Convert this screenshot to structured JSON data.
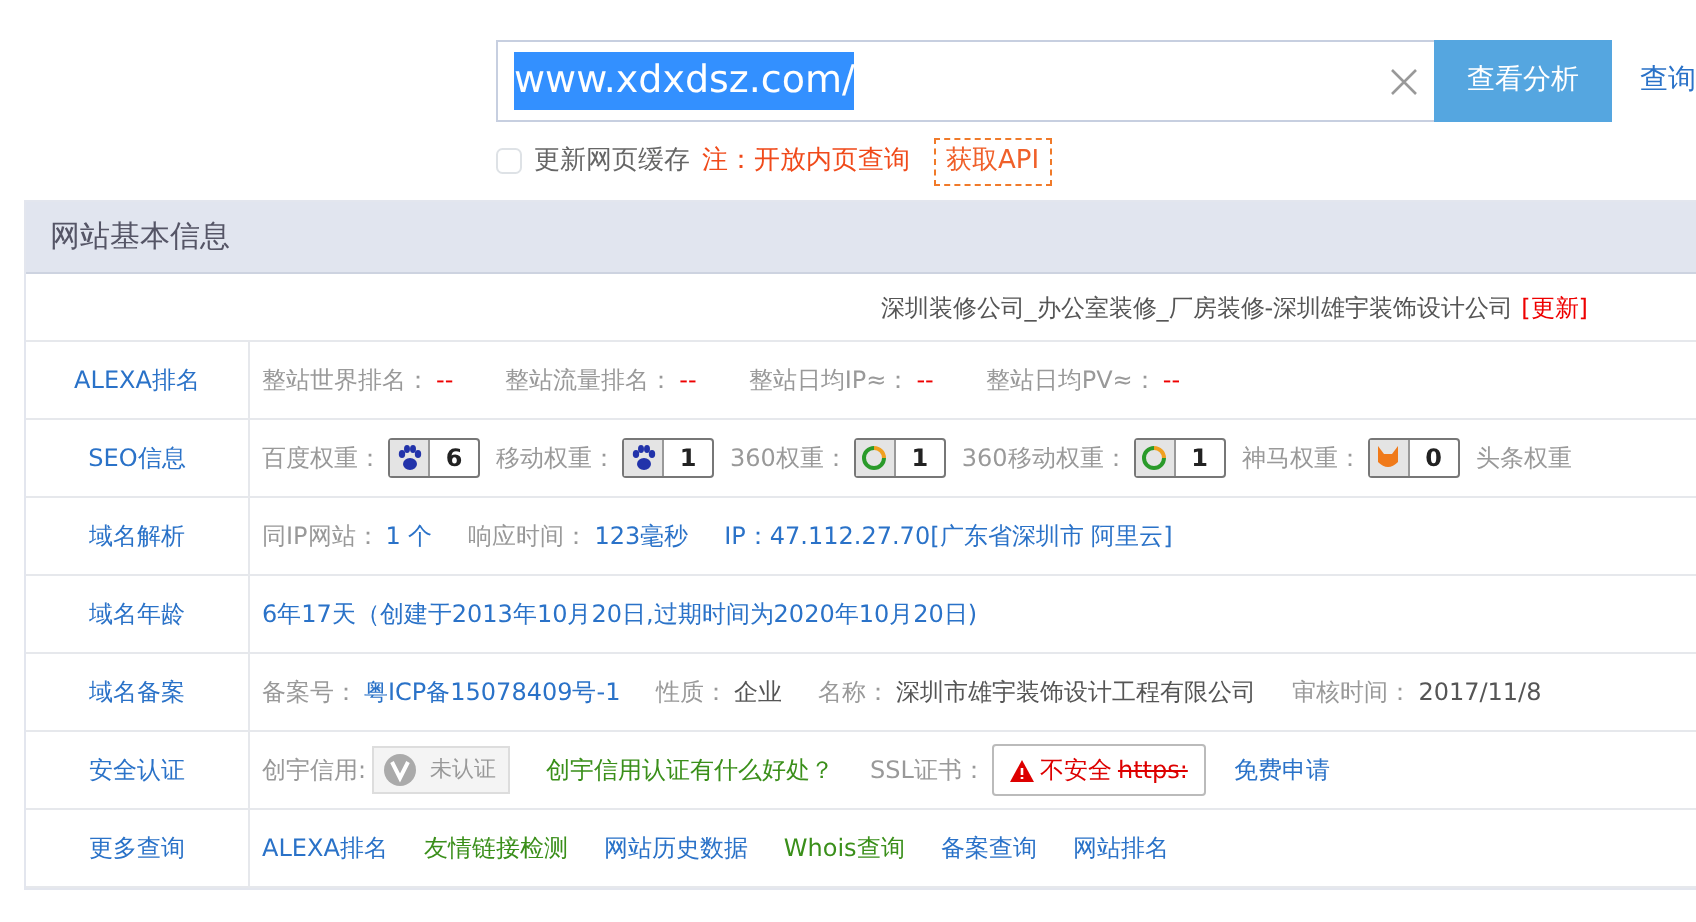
{
  "search": {
    "value": "www.xdxdsz.com/",
    "button": "查看分析",
    "side_link": "查询"
  },
  "options": {
    "checkbox_label": "更新网页缓存",
    "checked": false,
    "note": "注：开放内页查询",
    "api": "获取API"
  },
  "section": {
    "title": "网站基本信息",
    "site_title": "深圳装修公司_办公室装修_厂房装修-深圳雄宇装饰设计公司",
    "refresh": "[更新]"
  },
  "rows": [
    {
      "label": "ALEXA排名",
      "items": [
        {
          "kind": "label",
          "text": "整站世界排名："
        },
        {
          "kind": "dash",
          "text": "--"
        },
        {
          "kind": "label",
          "text": "整站流量排名："
        },
        {
          "kind": "dash",
          "text": "--"
        },
        {
          "kind": "label",
          "text": "整站日均IP≈："
        },
        {
          "kind": "dash",
          "text": "--"
        },
        {
          "kind": "label",
          "text": "整站日均PV≈："
        },
        {
          "kind": "dash",
          "text": "--"
        }
      ]
    },
    {
      "label": "SEO信息",
      "items": [
        {
          "kind": "label",
          "text": "百度权重："
        },
        {
          "kind": "paw-badge",
          "text": "6"
        },
        {
          "kind": "label",
          "text": "移动权重："
        },
        {
          "kind": "paw-badge",
          "text": "1"
        },
        {
          "kind": "label",
          "text": "360权重："
        },
        {
          "kind": "ring-badge",
          "text": "1"
        },
        {
          "kind": "label",
          "text": "360移动权重："
        },
        {
          "kind": "ring-badge",
          "text": "1"
        },
        {
          "kind": "label",
          "text": "神马权重："
        },
        {
          "kind": "fox-badge",
          "text": "0"
        },
        {
          "kind": "label",
          "text": "头条权重"
        }
      ]
    },
    {
      "label": "域名解析",
      "items": [
        {
          "kind": "label",
          "text": "同IP网站："
        },
        {
          "kind": "link",
          "text": "1 个"
        },
        {
          "kind": "label",
          "text": "响应时间："
        },
        {
          "kind": "value",
          "text": "123毫秒"
        },
        {
          "kind": "link",
          "text": "IP：47.112.27.70[广东省深圳市 阿里云]"
        }
      ]
    },
    {
      "label": "域名年龄",
      "items": [
        {
          "kind": "value",
          "text": "6年17天（创建于2013年10月20日,过期时间为2020年10月20日)"
        }
      ]
    },
    {
      "label": "域名备案",
      "items": [
        {
          "kind": "label",
          "text": "备案号："
        },
        {
          "kind": "link",
          "text": "粤ICP备15078409号-1"
        },
        {
          "kind": "label",
          "text": "性质："
        },
        {
          "kind": "text",
          "text": "企业"
        },
        {
          "kind": "label",
          "text": "名称："
        },
        {
          "kind": "text",
          "text": "深圳市雄宇装饰设计工程有限公司"
        },
        {
          "kind": "label",
          "text": "审核时间："
        },
        {
          "kind": "text",
          "text": "2017/11/8"
        }
      ]
    },
    {
      "label": "安全认证",
      "items": [
        {
          "kind": "label",
          "text": "创宇信用:"
        },
        {
          "kind": "cert",
          "text": "未认证"
        },
        {
          "kind": "green",
          "text": "创宇信用认证有什么好处？"
        },
        {
          "kind": "label",
          "text": "SSL证书："
        },
        {
          "kind": "ssl",
          "text": "不安全",
          "strike": "https:"
        },
        {
          "kind": "link",
          "text": "免费申请"
        }
      ]
    },
    {
      "label": "更多查询",
      "items": [
        {
          "kind": "link",
          "text": "ALEXA排名"
        },
        {
          "kind": "green",
          "text": "友情链接检测"
        },
        {
          "kind": "link",
          "text": "网站历史数据"
        },
        {
          "kind": "green",
          "text": "Whois查询"
        },
        {
          "kind": "link",
          "text": "备案查询"
        },
        {
          "kind": "link",
          "text": "网站排名"
        }
      ]
    }
  ]
}
